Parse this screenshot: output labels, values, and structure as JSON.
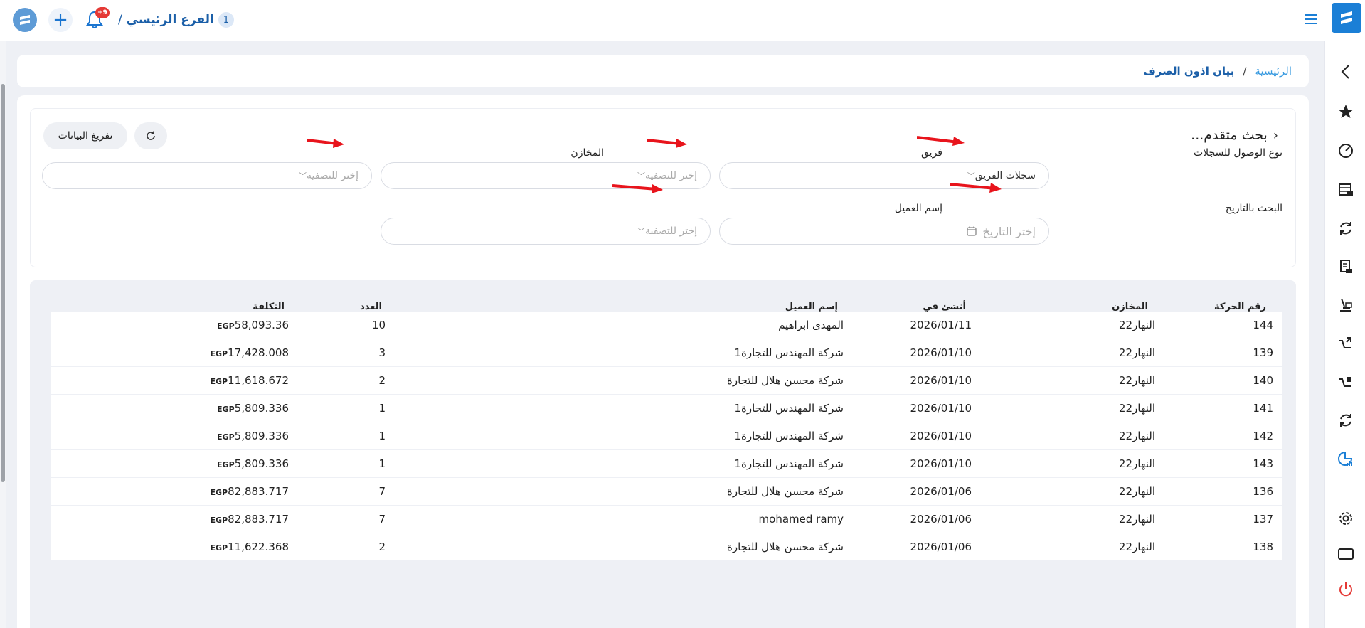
{
  "header": {
    "branch_count": "1",
    "branch_name": "الفرع الرئيسي",
    "branch_sep": "/",
    "notif_badge": "+9",
    "add_symbol": "+"
  },
  "breadcrumb": {
    "home": "الرئيسية",
    "sep": "/",
    "current": "بيان اذون الصرف"
  },
  "filters": {
    "title": "بحث متقدم...",
    "dump_label": "تفريغ البيانات",
    "access_label": "نوع الوصول للسجلات",
    "access_value": "سجلات الفريق",
    "team_label": "فريق",
    "team_placeholder": "إختر للتصفية",
    "stores_label": "المخازن",
    "stores_placeholder": "إختر للتصفية",
    "date_label": "البحث بالتاريخ",
    "date_placeholder": "إختر التاريخ",
    "customer_label": "إسم العميل",
    "customer_placeholder": "إختر للتصفية"
  },
  "table": {
    "headers": [
      "رقم الحركة",
      "المخازن",
      "أنشئ في",
      "إسم العميل",
      "العدد",
      "التكلفة"
    ],
    "currency": "EGP",
    "rows": [
      {
        "id": "144",
        "store": "النهار22",
        "date": "2026/01/11",
        "customer": "المهدى ابراهيم",
        "count": "10",
        "cost": "58,093.36"
      },
      {
        "id": "139",
        "store": "النهار22",
        "date": "2026/01/10",
        "customer": "شركة المهندس للتجارة1",
        "count": "3",
        "cost": "17,428.008"
      },
      {
        "id": "140",
        "store": "النهار22",
        "date": "2026/01/10",
        "customer": "شركة محسن هلال للتجارة",
        "count": "2",
        "cost": "11,618.672"
      },
      {
        "id": "141",
        "store": "النهار22",
        "date": "2026/01/10",
        "customer": "شركة المهندس للتجارة1",
        "count": "1",
        "cost": "5,809.336"
      },
      {
        "id": "142",
        "store": "النهار22",
        "date": "2026/01/10",
        "customer": "شركة المهندس للتجارة1",
        "count": "1",
        "cost": "5,809.336"
      },
      {
        "id": "143",
        "store": "النهار22",
        "date": "2026/01/10",
        "customer": "شركة المهندس للتجارة1",
        "count": "1",
        "cost": "5,809.336"
      },
      {
        "id": "136",
        "store": "النهار22",
        "date": "2026/01/06",
        "customer": "شركة محسن هلال للتجارة",
        "count": "7",
        "cost": "82,883.717"
      },
      {
        "id": "137",
        "store": "النهار22",
        "date": "2026/01/06",
        "customer": "mohamed ramy",
        "count": "7",
        "cost": "82,883.717"
      },
      {
        "id": "138",
        "store": "النهار22",
        "date": "2026/01/06",
        "customer": "شركة محسن هلال للتجارة",
        "count": "2",
        "cost": "11,622.368"
      }
    ]
  },
  "colors": {
    "accent": "#1b7fd6",
    "link": "#3a9be0",
    "annotation_arrow": "#e8141c",
    "badge": "#e53935"
  },
  "icons": [
    "menu-icon",
    "brand-logo-icon",
    "bell-icon",
    "chevron-left-icon",
    "star-icon",
    "gauge-icon",
    "store-icon",
    "sync-icon",
    "invoice-icon",
    "stamp-icon",
    "transfer-out-icon",
    "transfer-in-icon",
    "sync-icon",
    "report-icon",
    "gear-icon",
    "window-icon",
    "power-icon",
    "refresh-icon",
    "calendar-icon"
  ]
}
